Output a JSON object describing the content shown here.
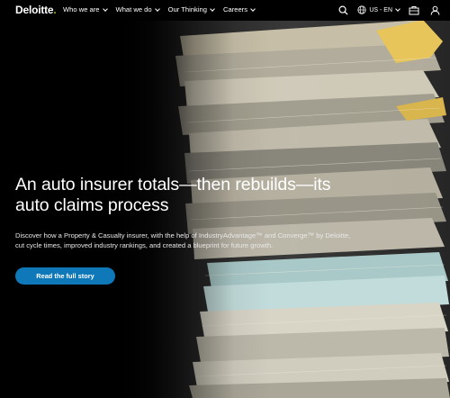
{
  "nav": {
    "logo_text": "Deloitte",
    "logo_dot": ".",
    "brand_green": "#86bc25",
    "items": [
      {
        "label": "Who we are"
      },
      {
        "label": "What we do"
      },
      {
        "label": "Our Thinking"
      },
      {
        "label": "Careers"
      }
    ],
    "language": "US - EN",
    "icons": [
      "search-icon",
      "globe-icon",
      "briefcase-icon",
      "user-icon"
    ]
  },
  "hero": {
    "title": "An auto insurer totals—then rebuilds—its auto claims process",
    "subtitle": "Discover how a Property & Casualty insurer, with the help of IndustryAdvantage™ and Converge™ by Deloitte, cut cycle times, improved industry rankings, and created a blueprint for future growth.",
    "cta_label": "Read the full story",
    "cta_color": "#0f78b8"
  }
}
